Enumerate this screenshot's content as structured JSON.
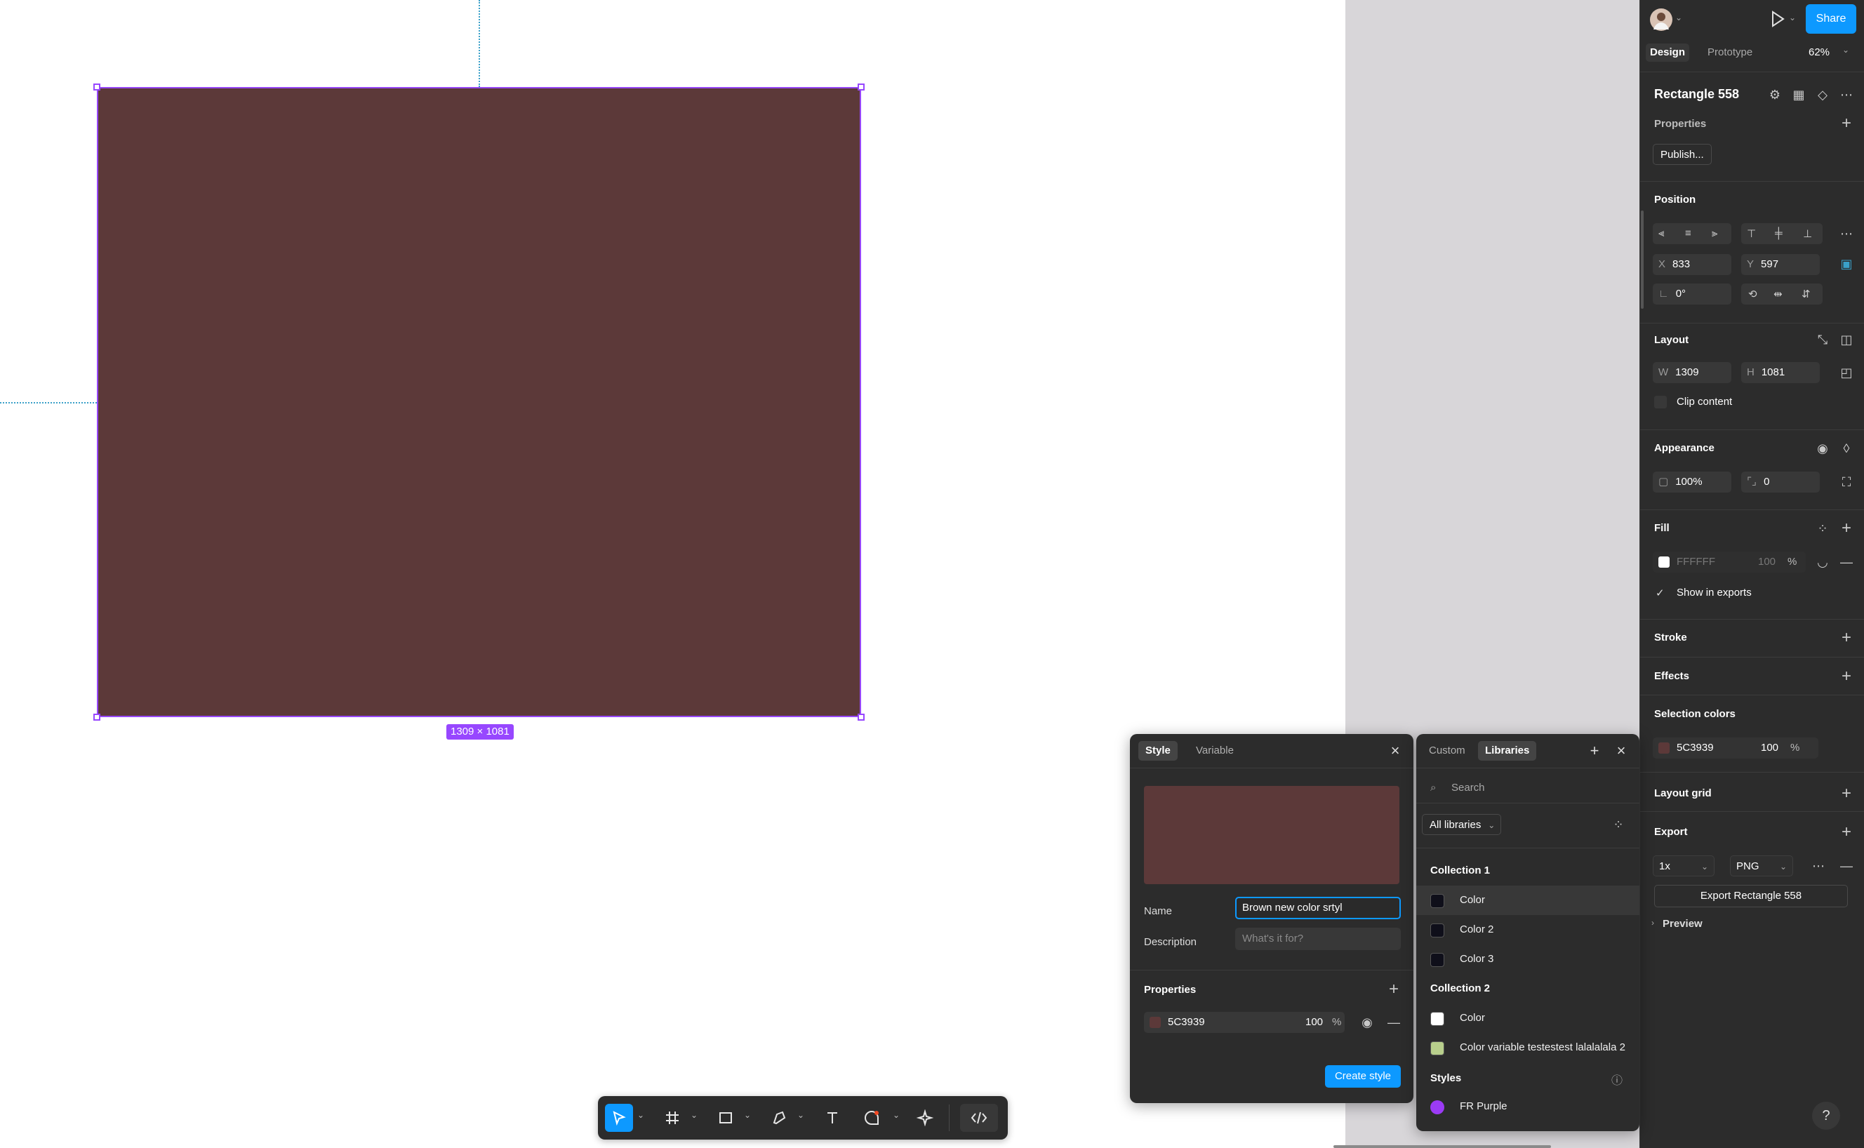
{
  "colors": {
    "accent": "#0d99ff",
    "selection": "#9747ff",
    "rect_fill": "#5c3939",
    "panel_bg": "#2c2c2c"
  },
  "canvas": {
    "dimension_label": "1309 × 1081"
  },
  "header": {
    "share_label": "Share",
    "tabs": [
      "Design",
      "Prototype"
    ],
    "zoom": "62%"
  },
  "layer": {
    "name": "Rectangle 558"
  },
  "properties": {
    "title": "Properties",
    "publish_label": "Publish..."
  },
  "position": {
    "title": "Position",
    "x_label": "X",
    "x": "833",
    "y_label": "Y",
    "y": "597",
    "rotation": "0°"
  },
  "layout": {
    "title": "Layout",
    "w_label": "W",
    "w": "1309",
    "h_label": "H",
    "h": "1081",
    "clip_content": "Clip content"
  },
  "appearance": {
    "title": "Appearance",
    "opacity": "100%",
    "radius": "0"
  },
  "fill": {
    "title": "Fill",
    "hex": "FFFFFF",
    "opacity": "100",
    "pct": "%",
    "show_in_exports": "Show in exports"
  },
  "stroke": {
    "title": "Stroke"
  },
  "effects": {
    "title": "Effects"
  },
  "selection_colors": {
    "title": "Selection colors",
    "hex": "5C3939",
    "opacity": "100",
    "pct": "%"
  },
  "layout_grid": {
    "title": "Layout grid"
  },
  "export": {
    "title": "Export",
    "scale": "1x",
    "format": "PNG",
    "button": "Export Rectangle 558",
    "preview": "Preview"
  },
  "style_popup": {
    "tabs": [
      "Style",
      "Variable"
    ],
    "name_label": "Name",
    "name_value": "Brown new color srtyl",
    "description_label": "Description",
    "description_placeholder": "What's it for?",
    "properties_title": "Properties",
    "hex": "5C3939",
    "opacity": "100",
    "pct": "%",
    "create_button": "Create style"
  },
  "library_popup": {
    "tabs": [
      "Custom",
      "Libraries"
    ],
    "search_placeholder": "Search",
    "filter": "All libraries",
    "collection1": {
      "title": "Collection 1",
      "items": [
        {
          "label": "Color",
          "color": "#0f0f1a"
        },
        {
          "label": "Color 2",
          "color": "#0f0f1a"
        },
        {
          "label": "Color 3",
          "color": "#0f0f1a"
        }
      ]
    },
    "collection2": {
      "title": "Collection 2",
      "items": [
        {
          "label": "Color",
          "color": "#ffffff"
        },
        {
          "label": "Color variable testestest lalalalala 2",
          "color": "#b8cf8c"
        }
      ]
    },
    "styles": {
      "title": "Styles",
      "items": [
        {
          "label": "FR Purple",
          "color": "#9b3bf5"
        }
      ]
    }
  },
  "help_label": "?"
}
